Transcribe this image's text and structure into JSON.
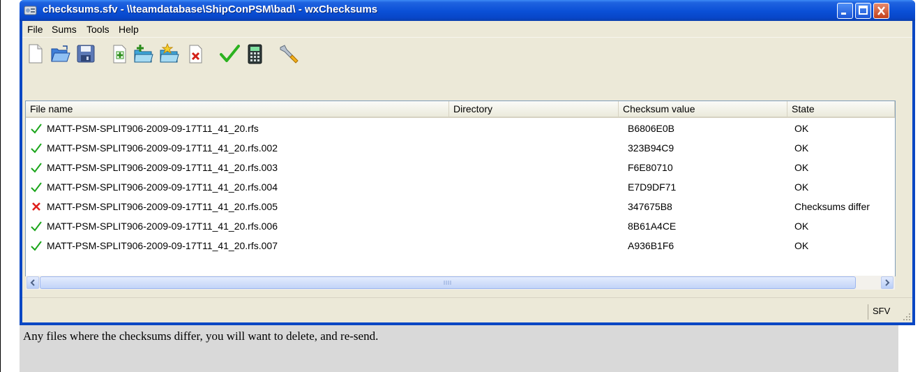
{
  "window": {
    "title": "checksums.sfv - \\\\teamdatabase\\ShipConPSM\\bad\\ - wxChecksums"
  },
  "menu": [
    "File",
    "Sums",
    "Tools",
    "Help"
  ],
  "toolbar": {
    "icons": [
      "new-file-icon",
      "open-folder-icon",
      "save-icon",
      "add-file-icon",
      "add-directory-icon",
      "add-matching-files-icon",
      "remove-file-icon",
      "check-icon",
      "calculator-icon",
      "configure-icon"
    ]
  },
  "list": {
    "columns": [
      "File name",
      "Directory",
      "Checksum value",
      "State"
    ],
    "rows": [
      {
        "status": "ok",
        "file": "MATT-PSM-SPLIT906-2009-09-17T11_41_20.rfs",
        "directory": "",
        "checksum": "B6806E0B",
        "state": "OK"
      },
      {
        "status": "ok",
        "file": "MATT-PSM-SPLIT906-2009-09-17T11_41_20.rfs.002",
        "directory": "",
        "checksum": "323B94C9",
        "state": "OK"
      },
      {
        "status": "ok",
        "file": "MATT-PSM-SPLIT906-2009-09-17T11_41_20.rfs.003",
        "directory": "",
        "checksum": "F6E80710",
        "state": "OK"
      },
      {
        "status": "ok",
        "file": "MATT-PSM-SPLIT906-2009-09-17T11_41_20.rfs.004",
        "directory": "",
        "checksum": "E7D9DF71",
        "state": "OK"
      },
      {
        "status": "error",
        "file": "MATT-PSM-SPLIT906-2009-09-17T11_41_20.rfs.005",
        "directory": "",
        "checksum": "347675B8",
        "state": "Checksums differ"
      },
      {
        "status": "ok",
        "file": "MATT-PSM-SPLIT906-2009-09-17T11_41_20.rfs.006",
        "directory": "",
        "checksum": "8B61A4CE",
        "state": "OK"
      },
      {
        "status": "ok",
        "file": "MATT-PSM-SPLIT906-2009-09-17T11_41_20.rfs.007",
        "directory": "",
        "checksum": "A936B1F6",
        "state": "OK"
      }
    ]
  },
  "status": {
    "format": "SFV"
  },
  "caption": "Any files where the checksums differ, you will want to delete, and re-send.",
  "colors": {
    "ok": "#1aa51a",
    "error": "#e0201c",
    "titlebar": "#0a4fd6"
  }
}
